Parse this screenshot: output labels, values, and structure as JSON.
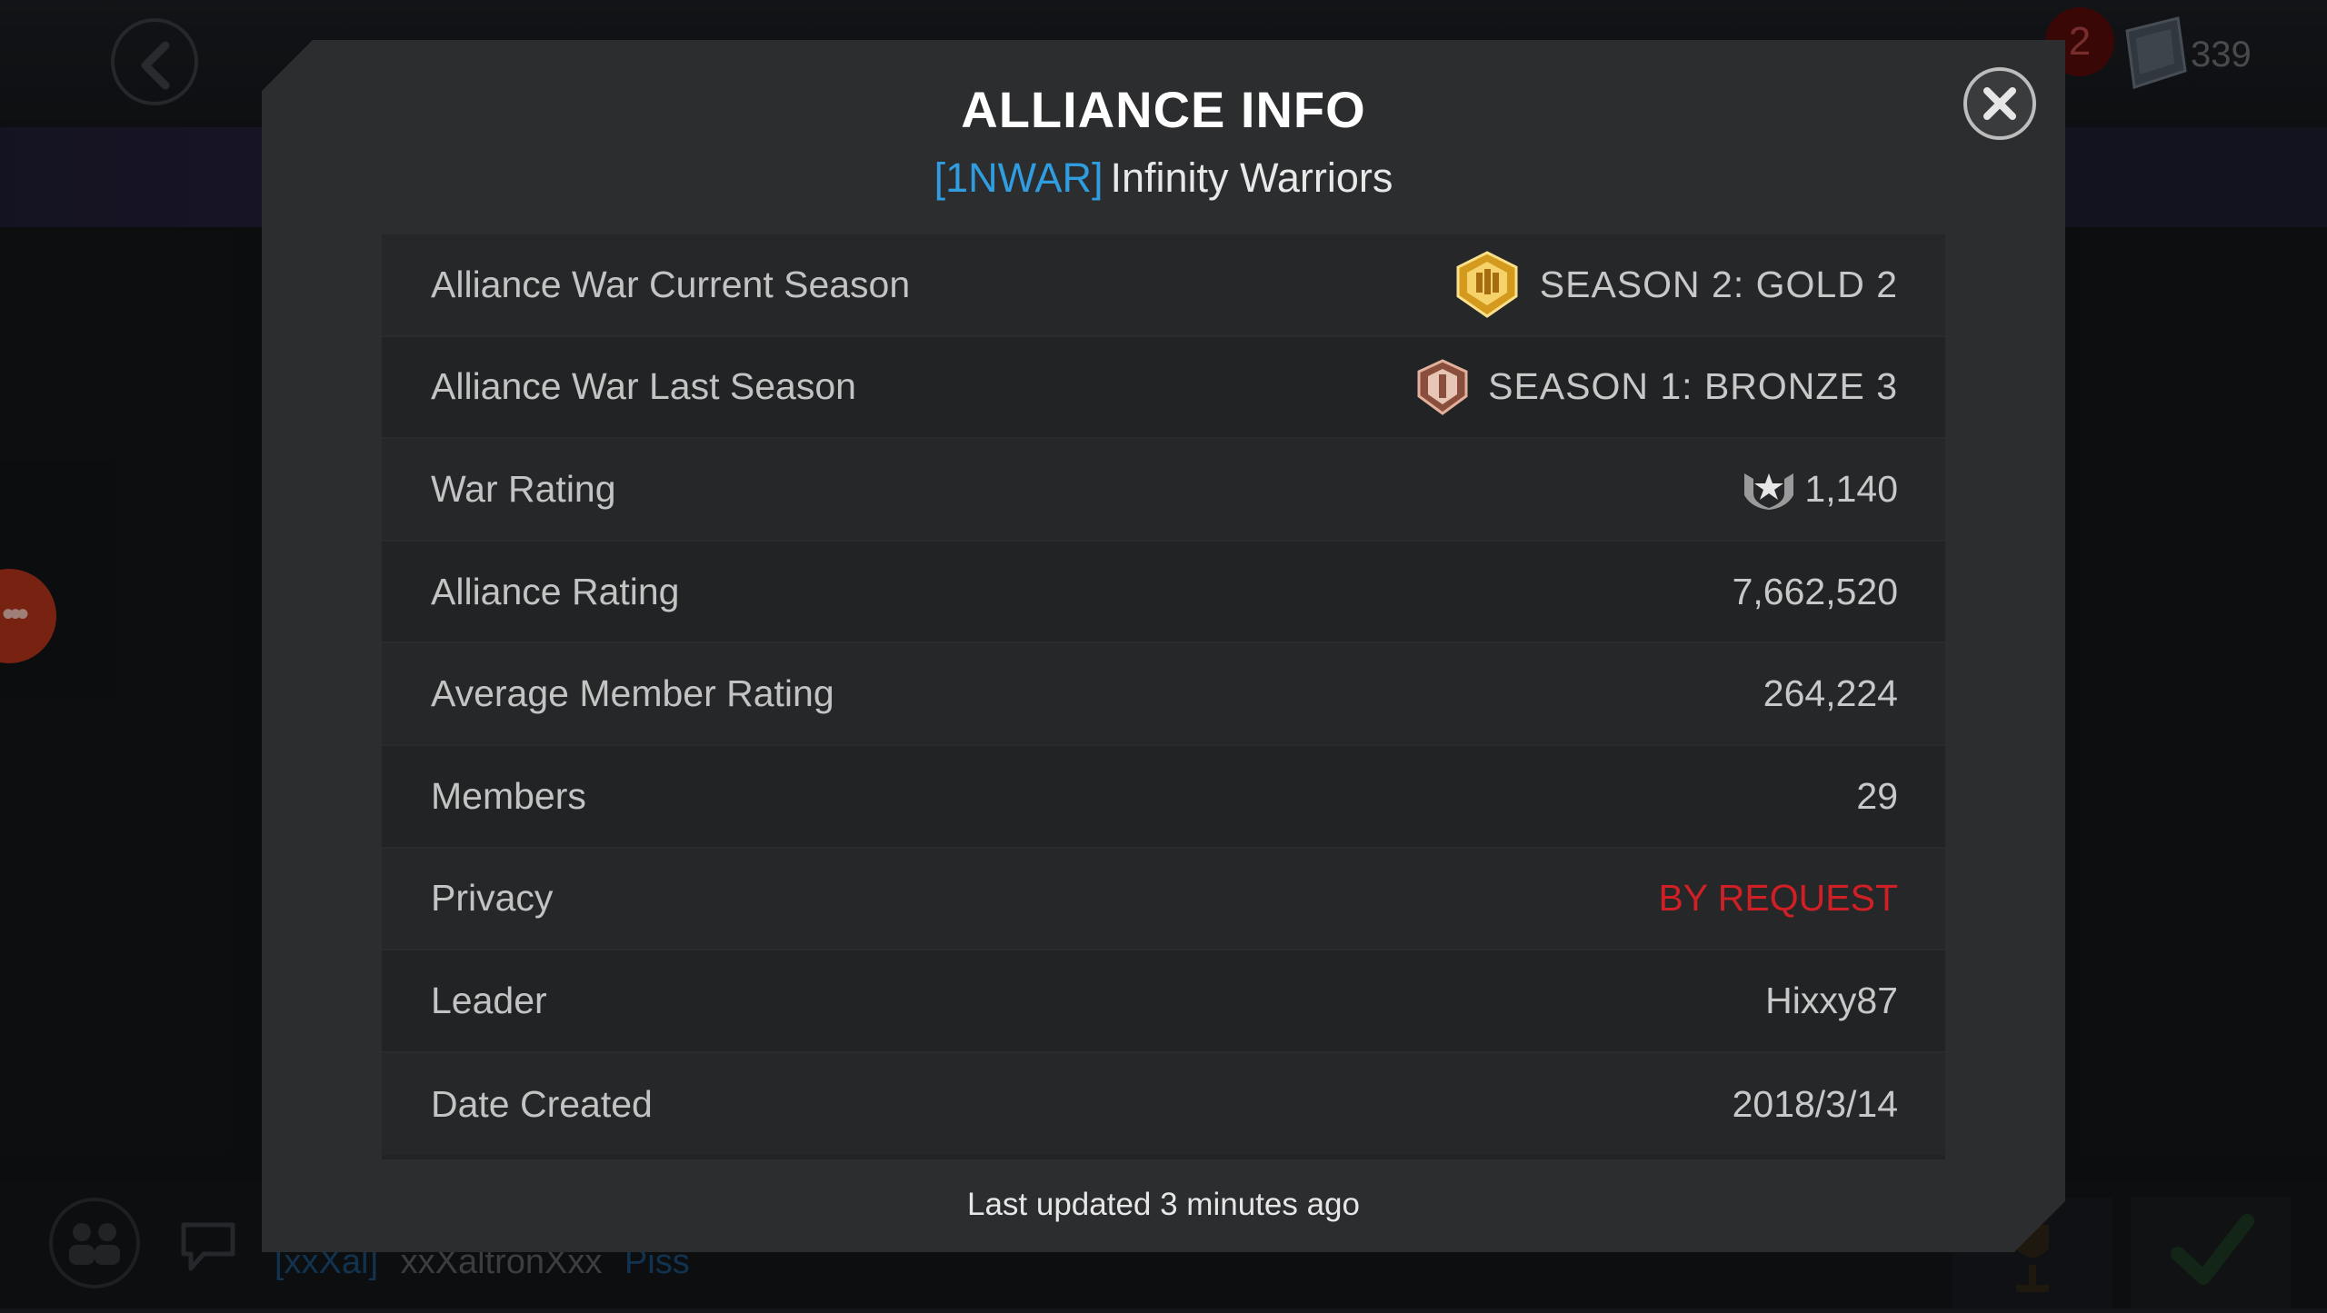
{
  "background": {
    "notification_count": "2",
    "currency_amount": "339",
    "chat_tag": "[xxXal]",
    "chat_user": "xxXaltronXxx",
    "chat_message": "Piss"
  },
  "modal": {
    "title": "ALLIANCE INFO",
    "alliance_tag": "[1NWAR]",
    "alliance_name": "Infinity Warriors",
    "rows": [
      {
        "label": "Alliance War Current Season",
        "value": "SEASON 2: GOLD 2",
        "icon": "gold-season-icon"
      },
      {
        "label": "Alliance War Last Season",
        "value": "SEASON 1: BRONZE 3",
        "icon": "bronze-season-icon"
      },
      {
        "label": "War Rating",
        "value": "1,140",
        "icon": "war-rating-icon"
      },
      {
        "label": "Alliance Rating",
        "value": "7,662,520"
      },
      {
        "label": "Average Member Rating",
        "value": "264,224"
      },
      {
        "label": "Members",
        "value": "29"
      },
      {
        "label": "Privacy",
        "value": "BY REQUEST"
      },
      {
        "label": "Leader",
        "value": "Hixxy87"
      },
      {
        "label": "Date Created",
        "value": "2018/3/14"
      }
    ],
    "footer": "Last updated 3 minutes ago"
  },
  "colors": {
    "tag_blue": "#2f9de0",
    "privacy_red": "#d01f25",
    "gold": "#f0b83a",
    "bronze": "#c9826b"
  }
}
